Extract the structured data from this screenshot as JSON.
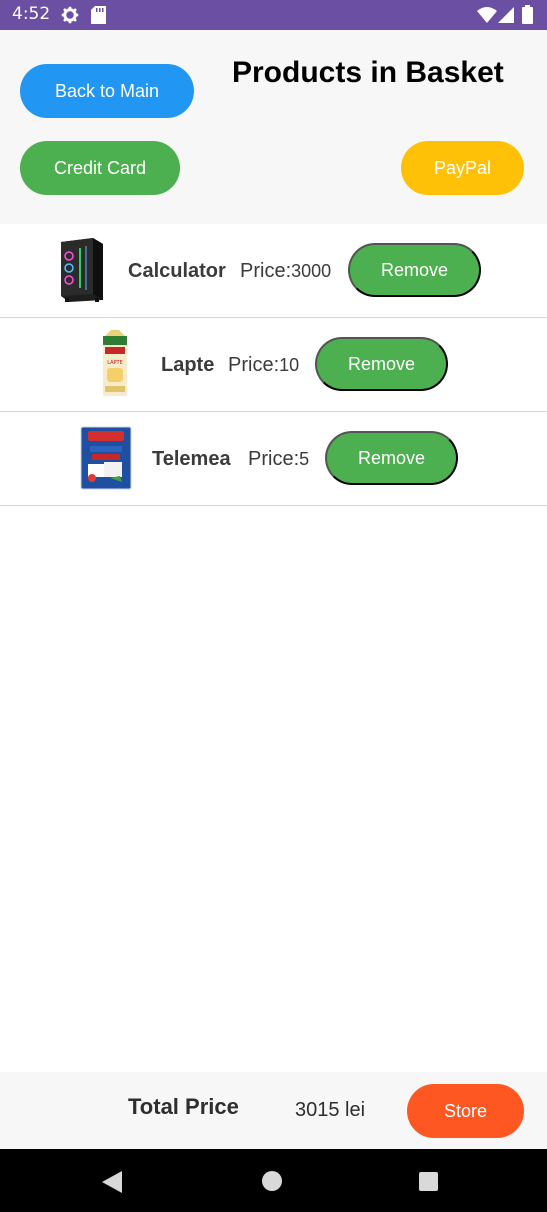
{
  "status_bar": {
    "time": "4:52",
    "icons": [
      "gear-icon",
      "sd-card-icon",
      "wifi-icon",
      "signal-icon",
      "battery-icon"
    ]
  },
  "header": {
    "title": "Products in Basket",
    "back_button": "Back to Main",
    "credit_card_button": "Credit Card",
    "paypal_button": "PayPal"
  },
  "products": [
    {
      "name": "Calculator",
      "price_label": "Price:",
      "price": "3000",
      "remove_label": "Remove",
      "image": "computer-case-image"
    },
    {
      "name": "Lapte",
      "price_label": "Price:",
      "price": "10",
      "remove_label": "Remove",
      "image": "milk-carton-image"
    },
    {
      "name": "Telemea",
      "price_label": "Price:",
      "price": "5",
      "remove_label": "Remove",
      "image": "cheese-package-image"
    }
  ],
  "footer": {
    "total_label": "Total Price",
    "total_value": "3015 lei",
    "store_button": "Store"
  },
  "colors": {
    "status_bar": "#6a4fa3",
    "back_button": "#2196f3",
    "credit_card_button": "#4caf50",
    "paypal_button": "#ffc107",
    "remove_button": "#4caf50",
    "store_button": "#ff5722"
  },
  "nav_bar": {
    "icons": [
      "back-icon",
      "home-icon",
      "recents-icon"
    ]
  }
}
